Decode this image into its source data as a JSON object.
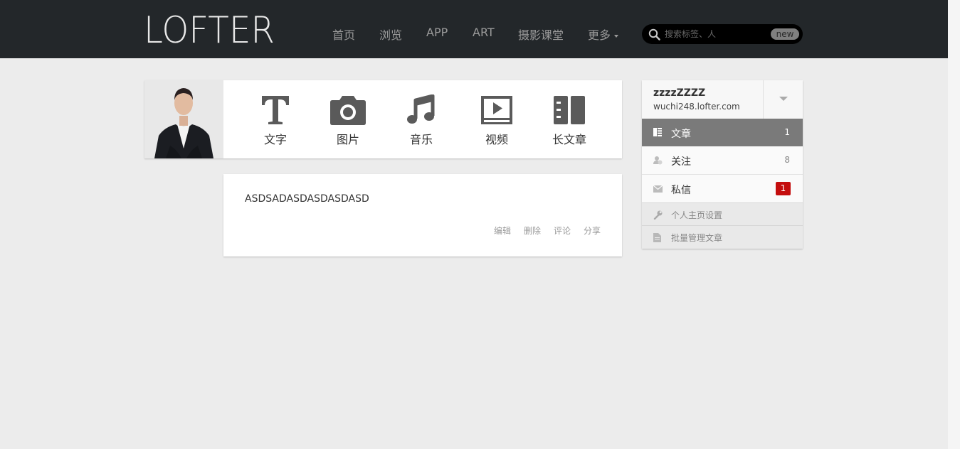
{
  "brand": {
    "logo_text": "LOFTER"
  },
  "nav": [
    {
      "label": "首页"
    },
    {
      "label": "浏览"
    },
    {
      "label": "APP"
    },
    {
      "label": "ART"
    },
    {
      "label": "摄影课堂"
    },
    {
      "label": "更多"
    }
  ],
  "search": {
    "placeholder": "搜索标签、人",
    "badge": "new",
    "icon": "search-icon"
  },
  "post_types": [
    {
      "label": "文字",
      "icon": "text-icon"
    },
    {
      "label": "图片",
      "icon": "camera-icon"
    },
    {
      "label": "音乐",
      "icon": "music-icon"
    },
    {
      "label": "视频",
      "icon": "video-icon"
    },
    {
      "label": "长文章",
      "icon": "long-article-icon"
    }
  ],
  "post": {
    "text": "ASDSADASDASDASDASD",
    "actions": [
      {
        "label": "编辑"
      },
      {
        "label": "删除"
      },
      {
        "label": "评论"
      },
      {
        "label": "分享"
      }
    ]
  },
  "user": {
    "name": "zzzzZZZZ",
    "domain": "wuchi248.lofter.com",
    "menu": [
      {
        "label": "文章",
        "count": "1",
        "icon": "article-icon",
        "active": true
      },
      {
        "label": "关注",
        "count": "8",
        "icon": "follow-icon"
      },
      {
        "label": "私信",
        "badge": "1",
        "icon": "mail-icon"
      }
    ],
    "settings": [
      {
        "label": "个人主页设置",
        "icon": "wrench-icon"
      },
      {
        "label": "批量管理文章",
        "icon": "document-icon"
      }
    ]
  },
  "colors": {
    "header_bg": "#23272a",
    "active_row": "#7a7a7a",
    "badge_red": "#c40d0d",
    "icon_gray": "#5a5a5a"
  }
}
